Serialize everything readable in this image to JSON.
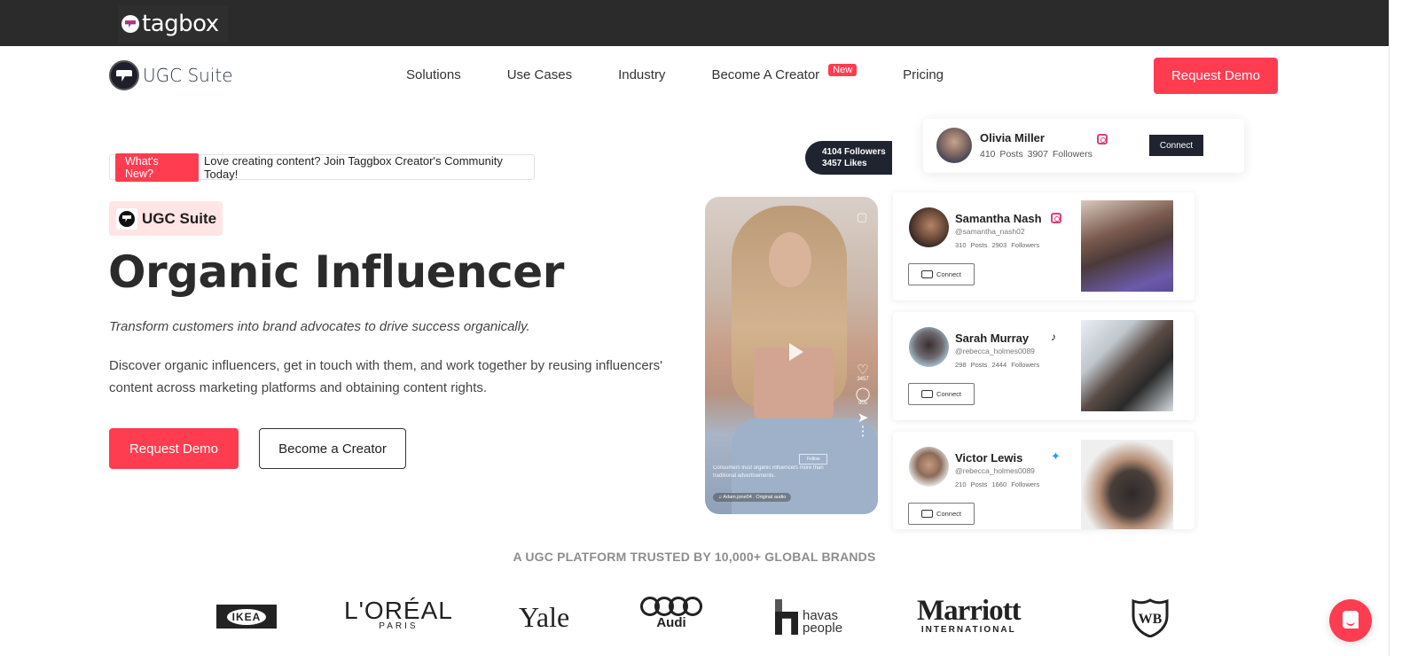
{
  "topbar": {
    "brand": "tagbox"
  },
  "nav": {
    "logo_text": "UGC Suite",
    "items": [
      {
        "label": "Solutions"
      },
      {
        "label": "Use Cases"
      },
      {
        "label": "Industry"
      },
      {
        "label": "Become A Creator",
        "badge": "New"
      },
      {
        "label": "Pricing"
      }
    ],
    "cta": "Request Demo"
  },
  "hero": {
    "announcement_tag": "What's New?",
    "announcement_text": "Love creating content? Join Taggbox Creator's Community Today!",
    "pill": "UGC Suite",
    "title": "Organic Influencer",
    "subtitle": "Transform customers into brand advocates to drive success organically.",
    "description": "Discover organic influencers, get in touch with them, and work together by reusing influencers' content across marketing platforms and obtaining content rights.",
    "primary_cta": "Request Demo",
    "secondary_cta": "Become a Creator"
  },
  "visual": {
    "stats": {
      "followers": "4104 Followers",
      "likes": "3457 Likes"
    },
    "phone": {
      "likes": "3457",
      "comments": "905",
      "follow": "Follow",
      "caption": "Consumers trust organic influencers more than traditional advertisements.",
      "audio": "♫ Adam.jone04 . Original audio"
    },
    "featured": {
      "name": "Olivia Miller",
      "meta": "410 Posts  3907 Followers",
      "platform": "instagram",
      "connect": "Connect"
    },
    "cards": [
      {
        "name": "Samantha Nash",
        "handle": "@samantha_nash02",
        "meta": "310 Posts  2903 Followers",
        "platform": "instagram",
        "connect": "Connect"
      },
      {
        "name": "Sarah Murray",
        "handle": "@rebecca_holmes0089",
        "meta": "298 Posts  2444 Followers",
        "platform": "tiktok",
        "connect": "Connect"
      },
      {
        "name": "Victor Lewis",
        "handle": "@rebecca_holmes0089",
        "meta": "210 Posts  1660 Followers",
        "platform": "twitter",
        "connect": "Connect"
      }
    ]
  },
  "brands": {
    "title": "A UGC PLATFORM TRUSTED BY 10,000+ GLOBAL BRANDS",
    "ikea": "IKEA",
    "loreal": "L'ORÉAL",
    "loreal_sub": "PARIS",
    "yale": "Yale",
    "audi": "Audi",
    "havas_1": "havas",
    "havas_2": "people",
    "marriott": "Marriott",
    "marriott_sub": "INTERNATIONAL",
    "wb": "WB"
  },
  "colors": {
    "accent": "#ff3c50",
    "dark": "#2b2b2b",
    "navy": "#1f2430"
  }
}
